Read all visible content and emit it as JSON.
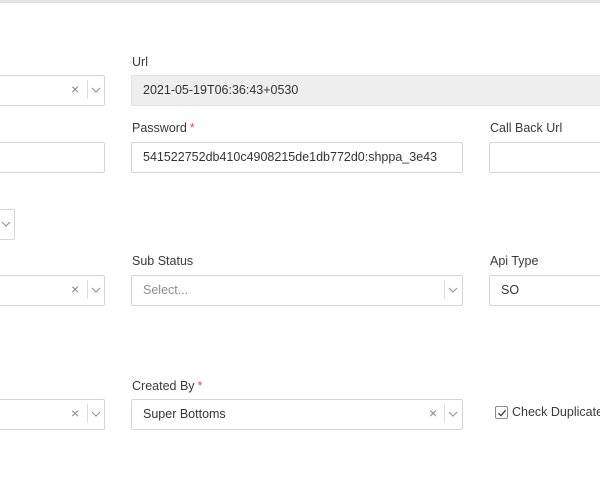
{
  "labels": {
    "url": "Url",
    "password": "Password",
    "call_back_url": "Call Back Url",
    "sub_status": "Sub Status",
    "api_type": "Api Type",
    "created_by": "Created By",
    "required_mark": "*"
  },
  "fields": {
    "url_value": "2021-05-19T06:36:43+0530",
    "password_value": "541522752db410c4908215de1db772d0:shppa_3e43",
    "call_back_url_value": "",
    "sub_status_placeholder": "Select...",
    "api_type_value": "SO",
    "created_by_value": "Super Bottoms",
    "check_duplicate_label": "Check Duplicate",
    "check_duplicate_checked": true
  },
  "icons": {
    "clear": "clear-x-icon",
    "dropdown": "chevron-down-icon",
    "checkbox_mark": "checkmark-icon"
  },
  "colors": {
    "required": "#d9534f",
    "readonly_bg": "#eeeeee",
    "border": "#d5d5d5"
  }
}
